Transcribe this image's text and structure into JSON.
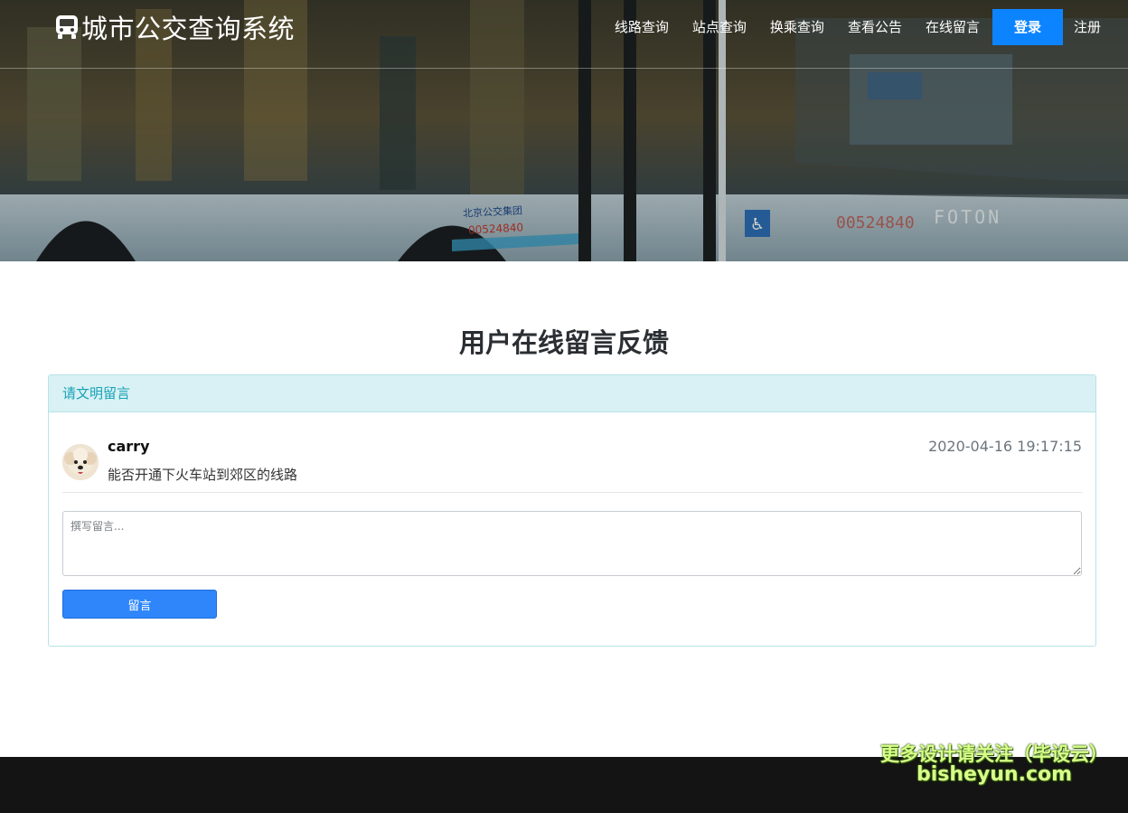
{
  "header": {
    "brand": "城市公交查询系统",
    "nav": [
      {
        "label": "线路查询"
      },
      {
        "label": "站点查询"
      },
      {
        "label": "换乘查询"
      },
      {
        "label": "查看公告"
      },
      {
        "label": "在线留言"
      }
    ],
    "login_label": "登录",
    "register_label": "注册",
    "accent": "#0d84ff"
  },
  "hero": {
    "bus_logo_text": "FOTON",
    "bus_company": "北京公交集团",
    "bus_plate": "00524840",
    "bus_number_front": "00524840"
  },
  "main": {
    "title": "用户在线留言反馈",
    "card_header": "请文明留言",
    "messages": [
      {
        "user": "carry",
        "time": "2020-04-16 19:17:15",
        "text": "能否开通下火车站到郊区的线路"
      }
    ],
    "input_placeholder": "撰写留言...",
    "submit_label": "留言"
  },
  "watermark": {
    "line1": "更多设计请关注（毕设云）",
    "line2": "bisheyun.com"
  }
}
